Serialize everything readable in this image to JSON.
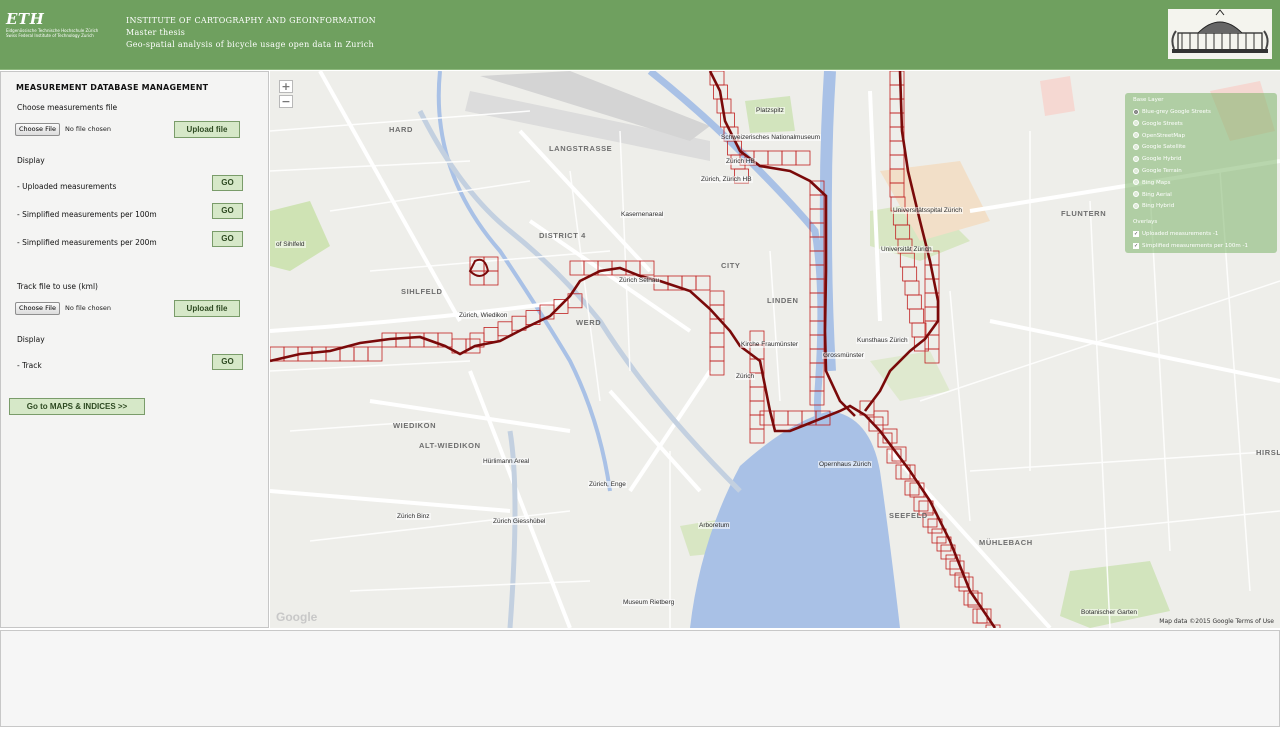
{
  "header": {
    "logo_text": "ETH",
    "logo_sub1": "Eidgenössische Technische Hochschule Zürich",
    "logo_sub2": "Swiss Federal Institute of Technology Zurich",
    "line1": "INSTITUTE OF CARTOGRAPHY AND GEOINFORMATION",
    "line2": "Master thesis",
    "line3": "Geo-spatial analysis of bicycle usage open data in Zurich"
  },
  "sidebar": {
    "title": "MEASUREMENT DATABASE MANAGEMENT",
    "choose_label": "Choose measurements file",
    "choose_file_btn": "Choose File",
    "no_file": "No file chosen",
    "upload_btn": "Upload file",
    "display_label": "Display",
    "items": [
      {
        "label": "- Uploaded measurements",
        "btn": "GO"
      },
      {
        "label": "- Simplified measurements per 100m",
        "btn": "GO"
      },
      {
        "label": "- Simplified measurements per 200m",
        "btn": "GO"
      }
    ],
    "track_label": "Track file to use (kml)",
    "track_choose_btn": "Choose File",
    "track_no_file": "No file chosen",
    "track_upload_btn": "Upload file",
    "track_display_label": "Display",
    "track_item": {
      "label": "- Track",
      "btn": "GO"
    },
    "maps_btn": "Go to MAPS & INDICES >>"
  },
  "map": {
    "zoom_in": "+",
    "zoom_out": "−",
    "google_logo": "Google",
    "attribution": "Map data ©2015 Google  Terms of Use",
    "layers": {
      "base_title": "Base Layer",
      "base_options": [
        {
          "label": "Blue-grey Google Streets",
          "selected": true
        },
        {
          "label": "Google Streets",
          "selected": false
        },
        {
          "label": "OpenStreetMap",
          "selected": false
        },
        {
          "label": "Google Satellite",
          "selected": false
        },
        {
          "label": "Google Hybrid",
          "selected": false
        },
        {
          "label": "Google Terrain",
          "selected": false
        },
        {
          "label": "Bing Maps",
          "selected": false
        },
        {
          "label": "Bing Aerial",
          "selected": false
        },
        {
          "label": "Bing Hybrid",
          "selected": false
        }
      ],
      "overlay_title": "Overlays",
      "overlays": [
        {
          "label": "Uploaded measurements -1",
          "checked": true
        },
        {
          "label": "Simplified measurements per 100m -1",
          "checked": true
        }
      ]
    },
    "place_labels": [
      "LANGSTRASSE",
      "DISTRICT 4",
      "CITY",
      "WERD",
      "SIHLFELD",
      "LINDEN",
      "HARD",
      "WIEDIKON",
      "ALT-WIEDIKON",
      "SEEFELD",
      "MÜHLEBACH",
      "FLUNTERN",
      "HIRSLANDEN",
      "Zürich HB",
      "Zürich, Zürich HB",
      "Schweizerisches Nationalmuseum",
      "Universitätsspital Zürich",
      "Universität Zürich",
      "Zürich, Wiedikon",
      "Zürich Selnau",
      "Kirche Fraumünster",
      "Grossmünster",
      "Kunsthaus Zürich",
      "Opernhaus Zürich",
      "Zürich, Enge",
      "Zürich Binz",
      "Zürich Giesshübel",
      "Hürlimann Areal",
      "Museum Rietberg",
      "Botanischer Garten",
      "Arboretum",
      "Kasernenareal",
      "Platzspitz",
      "of Sihlfeld",
      "Zürich"
    ]
  },
  "colors": {
    "header_bg": "#6fa05f",
    "track": "#8b0d0d",
    "grid": "#c02020",
    "lake": "#a9c1e6"
  }
}
